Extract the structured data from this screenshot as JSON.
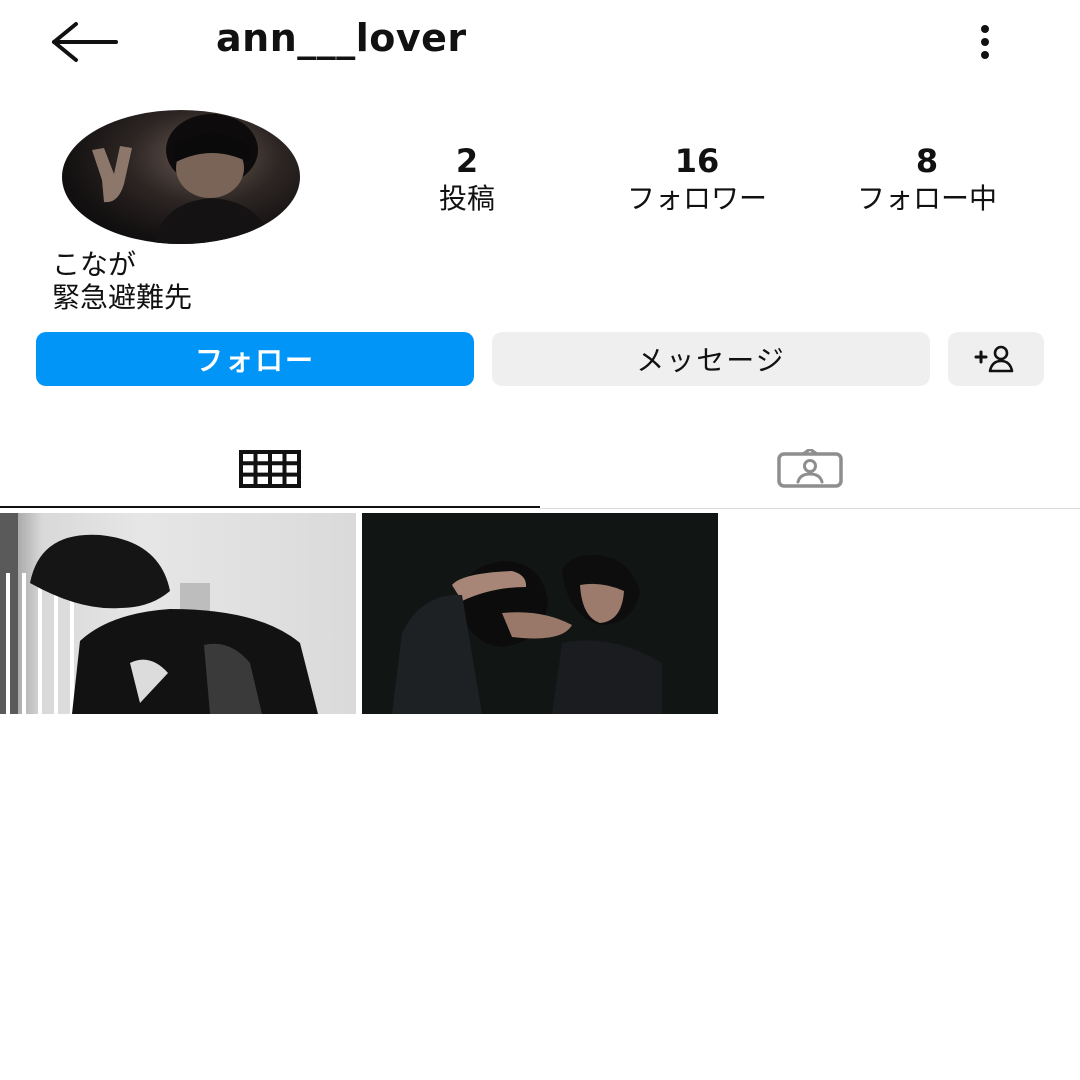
{
  "header": {
    "username": "ann___lover",
    "back_icon": "arrow-left-icon",
    "more_icon": "more-vertical-icon"
  },
  "profile": {
    "stats": {
      "posts": {
        "count": "2",
        "label": "投稿"
      },
      "followers": {
        "count": "16",
        "label": "フォロワー"
      },
      "following": {
        "count": "8",
        "label": "フォロー中"
      }
    },
    "bio": {
      "name": "こなが",
      "line": "緊急避難先"
    }
  },
  "actions": {
    "follow_label": "フォロー",
    "message_label": "メッセージ",
    "suggest_icon": "add-person-icon"
  },
  "tabs": [
    {
      "icon": "grid-icon",
      "active": true
    },
    {
      "icon": "tagged-person-icon",
      "active": false
    }
  ],
  "posts_count_shown": 2,
  "colors": {
    "follow_button": "#0095f6",
    "secondary_button": "#efefef",
    "text": "#111111"
  }
}
